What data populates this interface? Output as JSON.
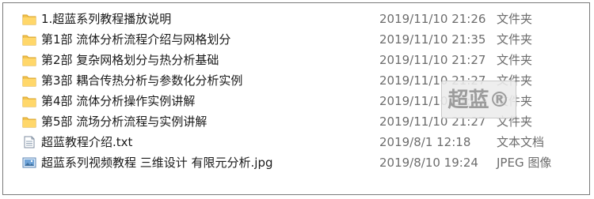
{
  "files": [
    {
      "name": "1.超蓝系列教程播放说明",
      "date": "2019/11/10 21:26",
      "type": "文件夹",
      "icon": "folder-icon"
    },
    {
      "name": "第1部 流体分析流程介绍与网格划分",
      "date": "2019/11/10 21:35",
      "type": "文件夹",
      "icon": "folder-icon"
    },
    {
      "name": "第2部 复杂网格划分与热分析基础",
      "date": "2019/11/10 21:27",
      "type": "文件夹",
      "icon": "folder-icon"
    },
    {
      "name": "第3部 耦合传热分析与参数化分析实例",
      "date": "2019/11/10 21:27",
      "type": "文件夹",
      "icon": "folder-icon"
    },
    {
      "name": "第4部 流体分析操作实例讲解",
      "date": "2019/11/10 21:27",
      "type": "文件夹",
      "icon": "folder-icon"
    },
    {
      "name": "第5部 流场分析流程与实例讲解",
      "date": "2019/11/10 21:27",
      "type": "文件夹",
      "icon": "folder-icon"
    },
    {
      "name": "超蓝教程介绍.txt",
      "date": "2019/8/1 12:18",
      "type": "文本文档",
      "icon": "text-file-icon"
    },
    {
      "name": "超蓝系列视频教程 三维设计 有限元分析.jpg",
      "date": "2019/8/10 19:24",
      "type": "JPEG 图像",
      "icon": "image-file-icon"
    }
  ],
  "watermark": {
    "text": "超蓝®"
  },
  "colors": {
    "folder": "#f3c34f",
    "text_primary": "#1a1a1a",
    "text_secondary": "#6d6d6d"
  }
}
